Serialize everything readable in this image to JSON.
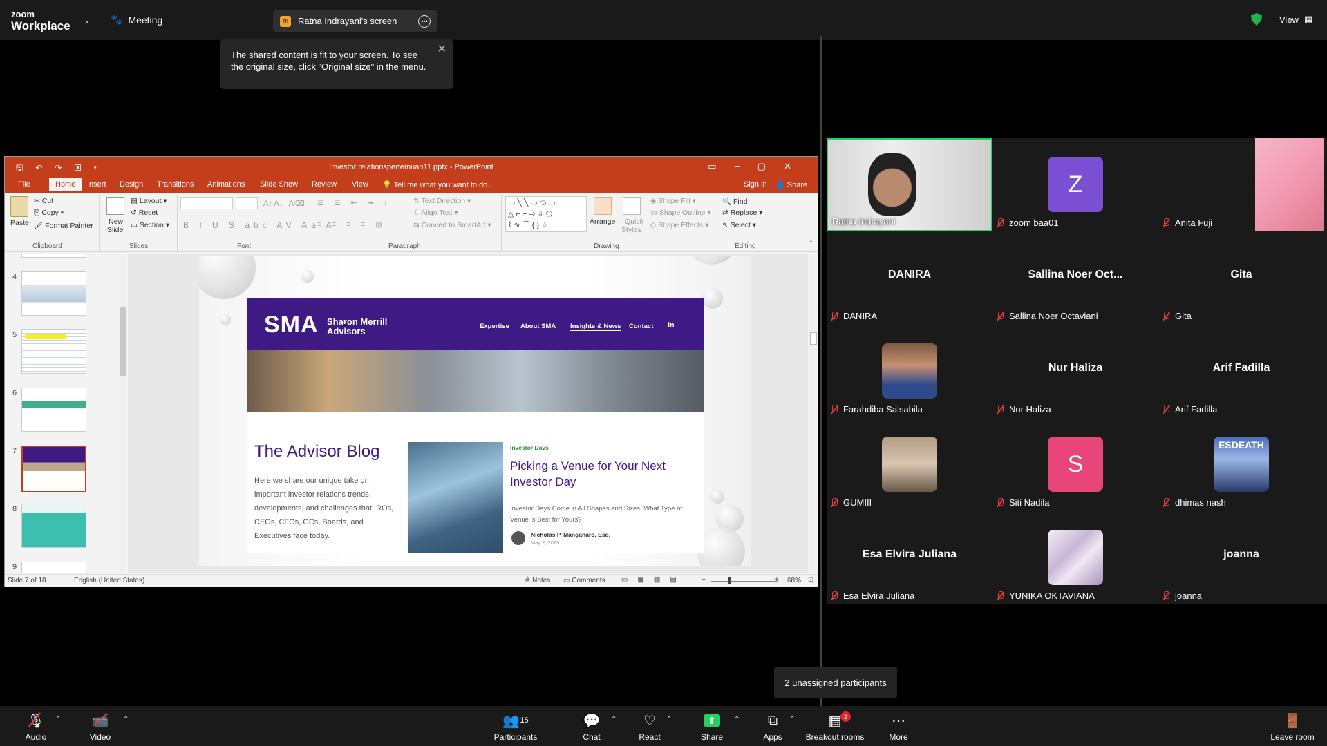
{
  "topbar": {
    "brand_top": "zoom",
    "brand_bottom": "Workplace",
    "meeting_label": "Meeting",
    "share_initials": "RI",
    "share_title": "Ratna Indrayani's screen",
    "view_label": "View"
  },
  "tooltip": {
    "text": "The shared content is fit to your screen. To see the original size, click \"Original size\" in the menu."
  },
  "ppt": {
    "window_title": "Investor relationspertemuan11.pptx - PowerPoint",
    "tabs": [
      "File",
      "Home",
      "Insert",
      "Design",
      "Transitions",
      "Animations",
      "Slide Show",
      "Review",
      "View"
    ],
    "tell_me": "Tell me what you want to do...",
    "sign_in": "Sign in",
    "share": "Share",
    "clipboard": {
      "paste": "Paste",
      "cut": "Cut",
      "copy": "Copy",
      "format_painter": "Format Painter",
      "label": "Clipboard"
    },
    "slides_group": {
      "new_slide_1": "New",
      "new_slide_2": "Slide",
      "layout": "Layout",
      "reset": "Reset",
      "section": "Section",
      "label": "Slides"
    },
    "font_group": {
      "label": "Font"
    },
    "paragraph_group": {
      "text_direction": "Text Direction",
      "align_text": "Align Text",
      "convert": "Convert to SmartArt",
      "label": "Paragraph"
    },
    "drawing_group": {
      "arrange": "Arrange",
      "quick_styles_1": "Quick",
      "quick_styles_2": "Styles",
      "shape_fill": "Shape Fill",
      "shape_outline": "Shape Outline",
      "shape_effects": "Shape Effects",
      "label": "Drawing"
    },
    "editing_group": {
      "find": "Find",
      "replace": "Replace",
      "select": "Select",
      "label": "Editing"
    },
    "thumb_numbers": [
      "4",
      "5",
      "6",
      "7",
      "8",
      "9"
    ],
    "status": {
      "slide": "Slide 7 of 18",
      "language": "English (United States)",
      "notes": "Notes",
      "comments": "Comments",
      "zoom": "68%"
    }
  },
  "slide": {
    "logo": "SMA",
    "company_1": "Sharon Merrill",
    "company_2": "Advisors",
    "nav": [
      "Expertise",
      "About SMA",
      "Insights & News",
      "Contact",
      "in"
    ],
    "blog_title": "The Advisor Blog",
    "blog_desc": "Here we share our unique take on important investor relations trends, developments, and challenges that IROs, CEOs, CFOs, GCs, Boards, and Executives face today.",
    "tag": "Investor Days",
    "post_title": "Picking a Venue for Your Next Investor Day",
    "post_sub": "Investor Days Come in All Shapes and Sizes; What Type of Venue is Best for Yours?",
    "author": "Nicholas P. Manganaro, Esq.",
    "date": "May 2, 2025"
  },
  "gallery": {
    "tiles": [
      {
        "name": "Ratna Indrayani",
        "type": "video"
      },
      {
        "name": "zoom baa01",
        "type": "avatar",
        "initial": "Z",
        "color": "#7a4fd4"
      },
      {
        "name": "Anita Fuji",
        "type": "image"
      },
      {
        "name": "DANIRA",
        "type": "text",
        "big": "DANIRA"
      },
      {
        "name": "Sallina Noer Octaviani",
        "type": "text",
        "big": "Sallina Noer Oct..."
      },
      {
        "name": "Gita",
        "type": "text",
        "big": "Gita"
      },
      {
        "name": "Farahdiba Salsabila",
        "type": "image"
      },
      {
        "name": "Nur Haliza",
        "type": "text",
        "big": "Nur Haliza"
      },
      {
        "name": "Arif Fadilla",
        "type": "text",
        "big": "Arif Fadilla"
      },
      {
        "name": "GUMIII",
        "type": "image"
      },
      {
        "name": "Siti Nadila",
        "type": "avatar",
        "initial": "S",
        "color": "#e8457a"
      },
      {
        "name": "dhimas nash",
        "type": "image"
      },
      {
        "name": "Esa Elvira Juliana",
        "type": "text",
        "big": "Esa Elvira Juliana"
      },
      {
        "name": "YUNIKA OKTAVIANA",
        "type": "image"
      },
      {
        "name": "joanna",
        "type": "text",
        "big": "joanna"
      }
    ],
    "esdeath_text": "ESDEATH"
  },
  "unassigned": "2 unassigned participants",
  "toolbar": {
    "audio": "Audio",
    "video": "Video",
    "participants": "Participants",
    "participants_count": "15",
    "chat": "Chat",
    "react": "React",
    "share": "Share",
    "apps": "Apps",
    "breakout": "Breakout rooms",
    "breakout_badge": "2",
    "more": "More",
    "leave": "Leave room"
  },
  "colors": {
    "zoom_green": "#23d160",
    "ppt_red": "#c43e1c",
    "sma_purple": "#3f1a85",
    "mute_red": "#e03e3e"
  }
}
